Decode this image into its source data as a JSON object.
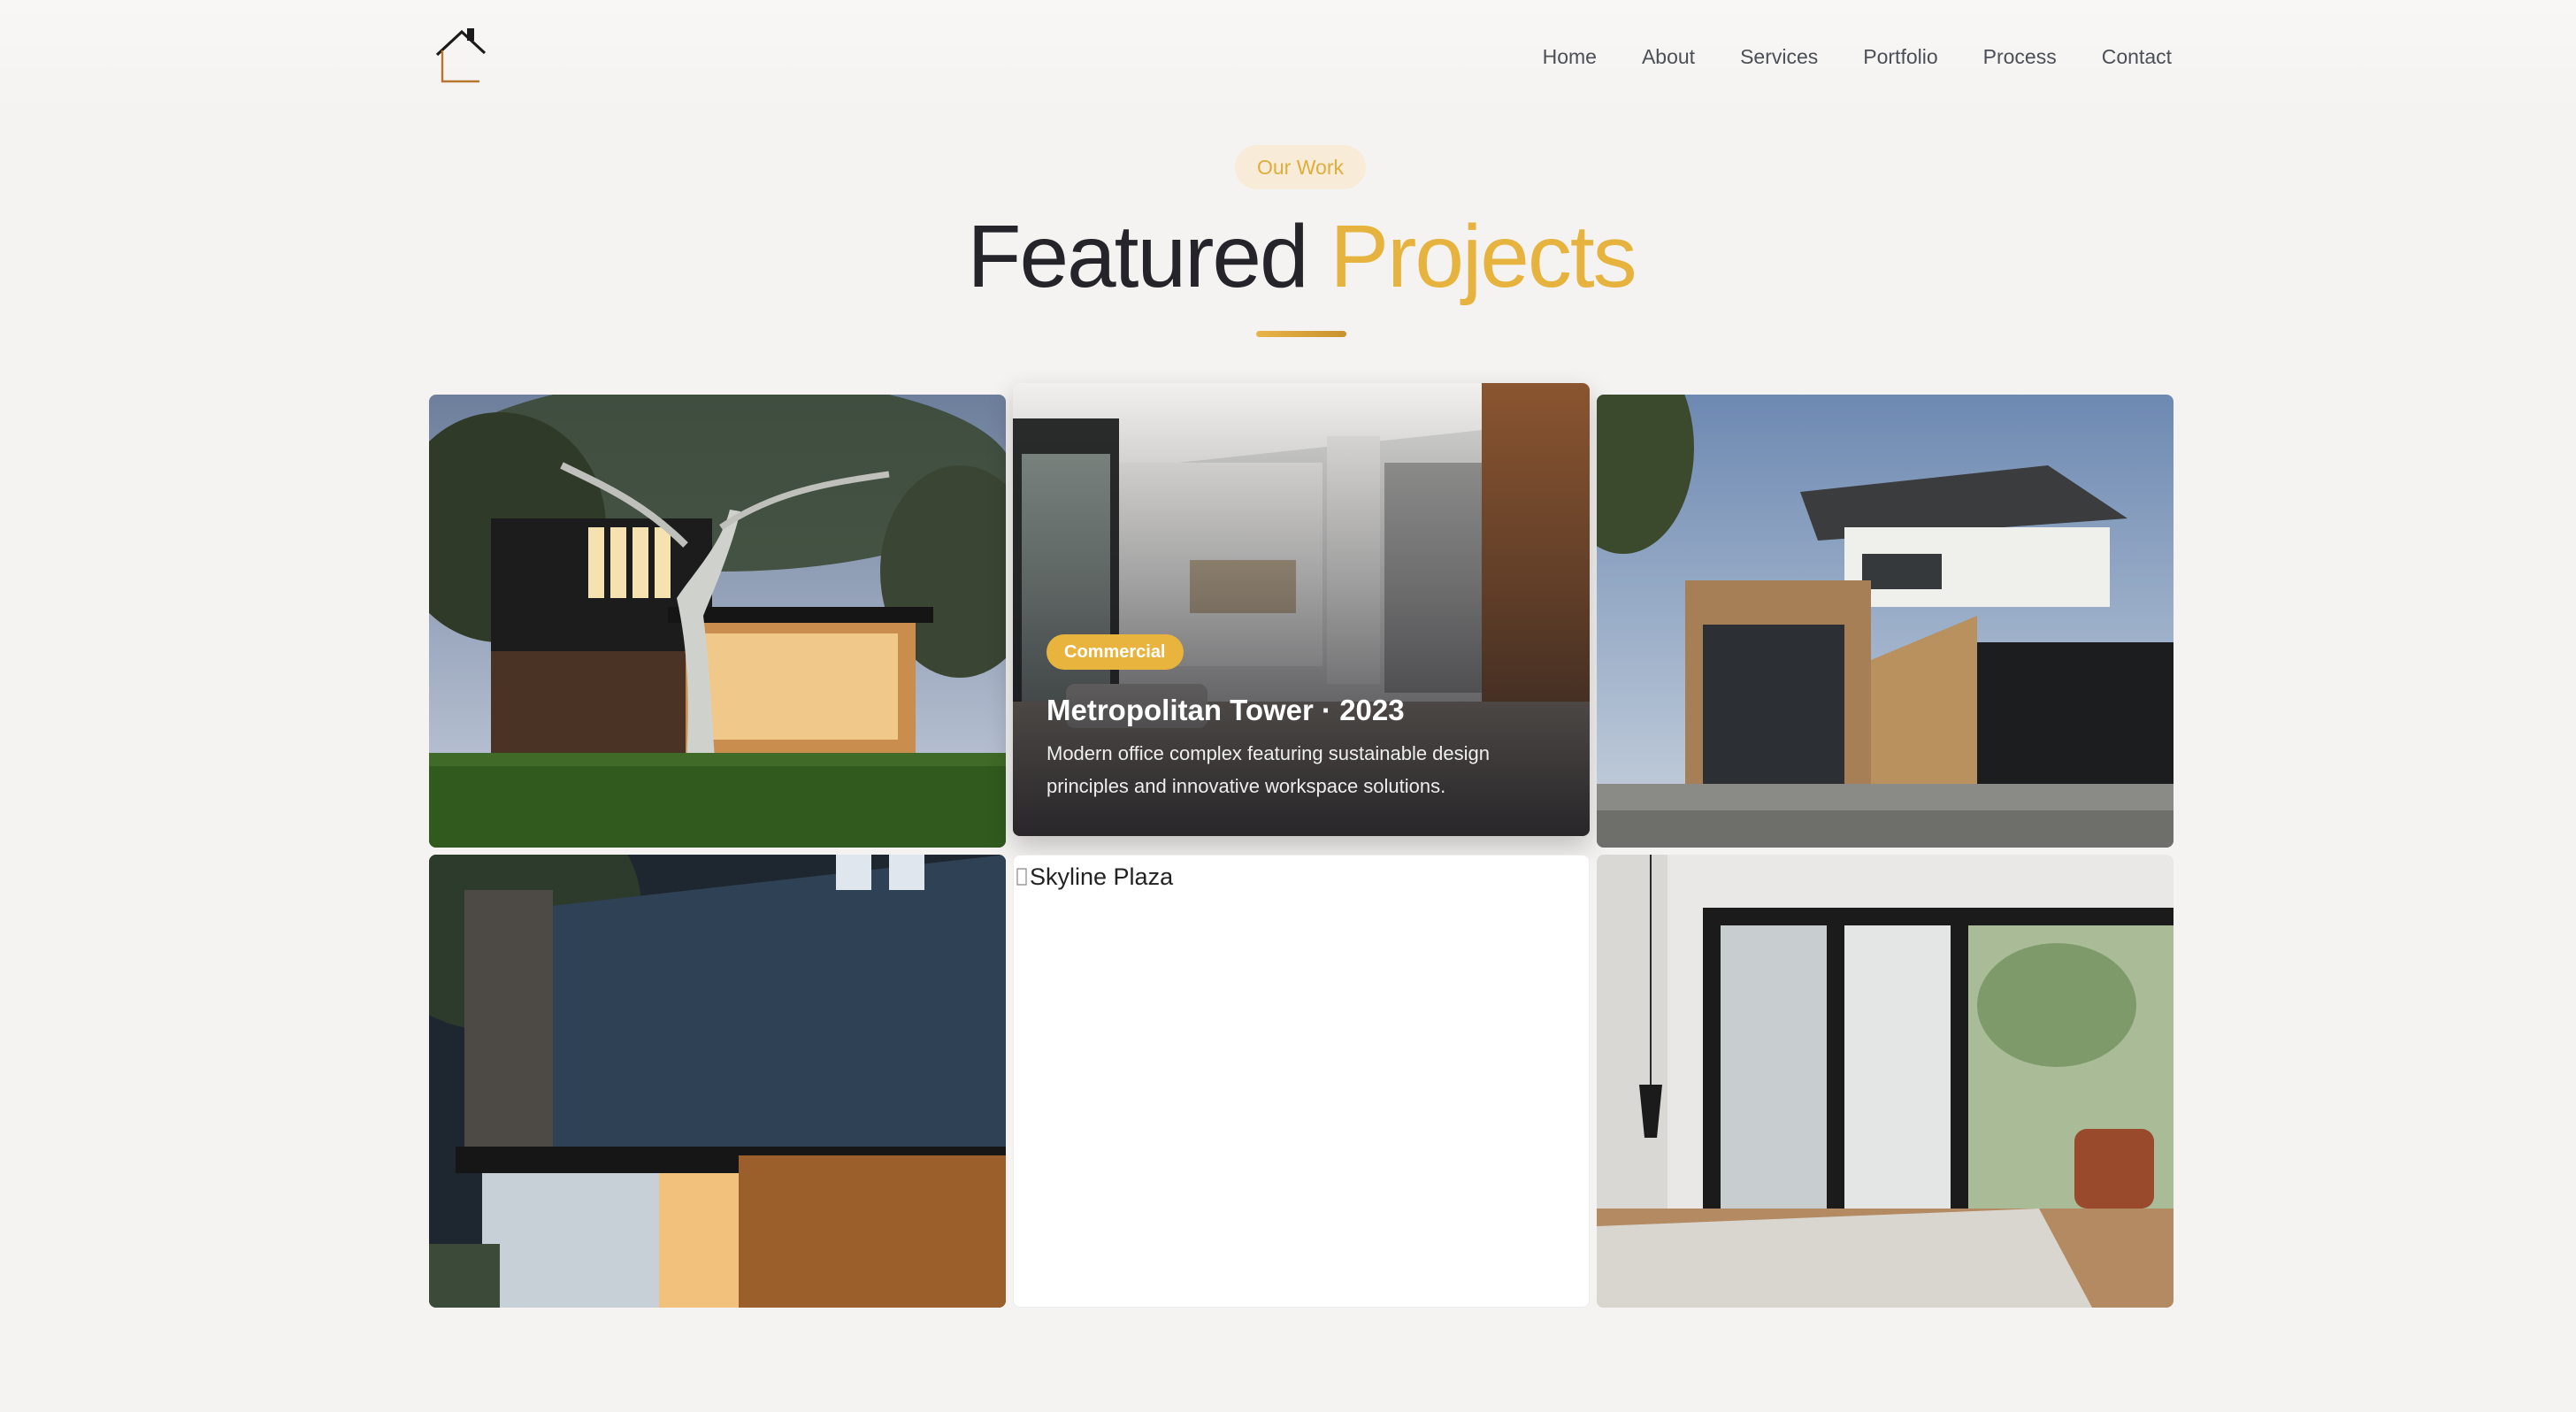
{
  "header": {
    "logo_icon": "house-icon",
    "nav": [
      "Home",
      "About",
      "Services",
      "Portfolio",
      "Process",
      "Contact"
    ]
  },
  "section": {
    "eyebrow": "Our Work",
    "title_main": "Featured",
    "title_accent": "Projects"
  },
  "colors": {
    "accent": "#e6b43e",
    "pill_bg": "#f8ecd8",
    "background": "#f5f3f1",
    "heading": "#24242a"
  },
  "projects": {
    "hovered": {
      "category": "Commercial",
      "title": "Metropolitan Tower · 2023",
      "description": "Modern office complex featuring sustainable design principles and innovative workspace solutions."
    },
    "broken_image_alt": "Skyline Plaza"
  }
}
